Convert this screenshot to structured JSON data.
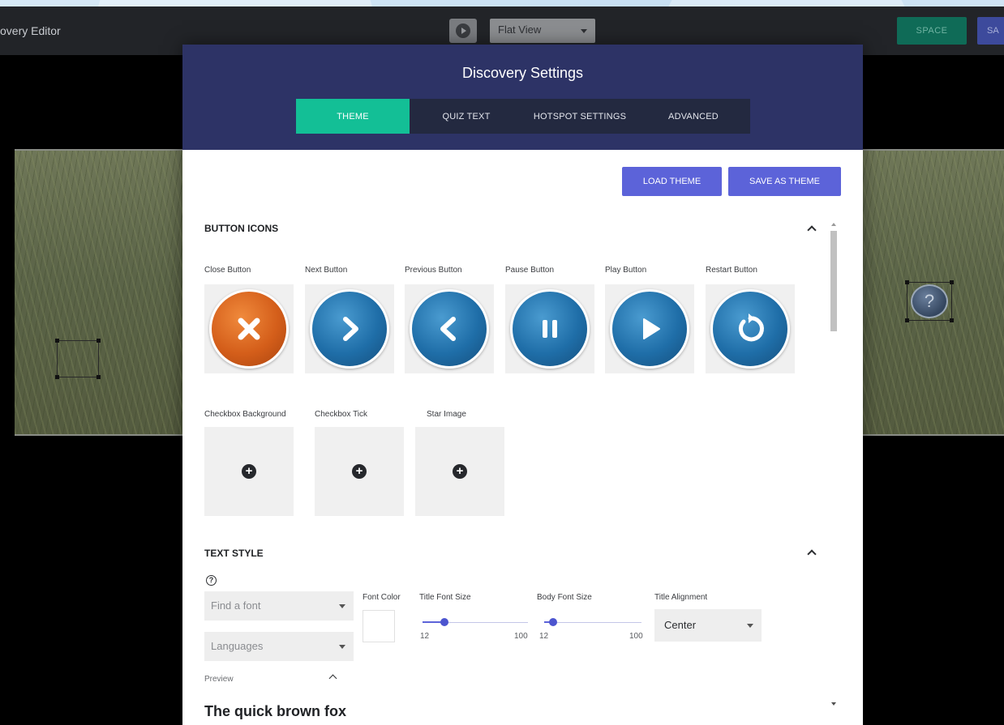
{
  "app": {
    "title": "overy Editor",
    "view_select": "Flat View",
    "space_button": "SPACE",
    "save_button": "SA"
  },
  "hotspot": {
    "question_mark": "?"
  },
  "modal": {
    "title": "Discovery Settings",
    "tabs": [
      {
        "label": "THEME",
        "active": true
      },
      {
        "label": "QUIZ TEXT",
        "active": false
      },
      {
        "label": "HOTSPOT SETTINGS",
        "active": false
      },
      {
        "label": "ADVANCED",
        "active": false
      }
    ],
    "load_theme": "LOAD THEME",
    "save_as_theme": "SAVE AS THEME",
    "button_icons": {
      "title": "BUTTON ICONS",
      "items": [
        {
          "label": "Close Button",
          "icon": "close-icon",
          "color": "#d45e1a"
        },
        {
          "label": "Next Button",
          "icon": "chevron-right-icon",
          "color": "#1f6ea8"
        },
        {
          "label": "Previous Button",
          "icon": "chevron-left-icon",
          "color": "#1f6ea8"
        },
        {
          "label": "Pause Button",
          "icon": "pause-icon",
          "color": "#1f6ea8"
        },
        {
          "label": "Play Button",
          "icon": "play-icon",
          "color": "#1f6ea8"
        },
        {
          "label": "Restart Button",
          "icon": "restart-icon",
          "color": "#1f6ea8"
        }
      ],
      "image_items": [
        {
          "label": "Checkbox Background"
        },
        {
          "label": "Checkbox Tick"
        },
        {
          "label": "Star Image"
        }
      ]
    },
    "text_style": {
      "title": "TEXT STYLE",
      "help_icon": "?",
      "font_placeholder": "Find a font",
      "languages_placeholder": "Languages",
      "preview_label": "Preview",
      "font_color_label": "Font Color",
      "title_font_size": {
        "label": "Title Font Size",
        "min": "12",
        "max": "100",
        "value": 30
      },
      "body_font_size": {
        "label": "Body Font Size",
        "min": "12",
        "max": "100",
        "value": 20
      },
      "title_alignment": {
        "label": "Title Alignment",
        "value": "Center"
      },
      "preview_text": "The quick brown fox"
    }
  },
  "colors": {
    "modal_header": "#2d3366",
    "tab_active": "#13bf96",
    "primary": "#5c63d9"
  }
}
